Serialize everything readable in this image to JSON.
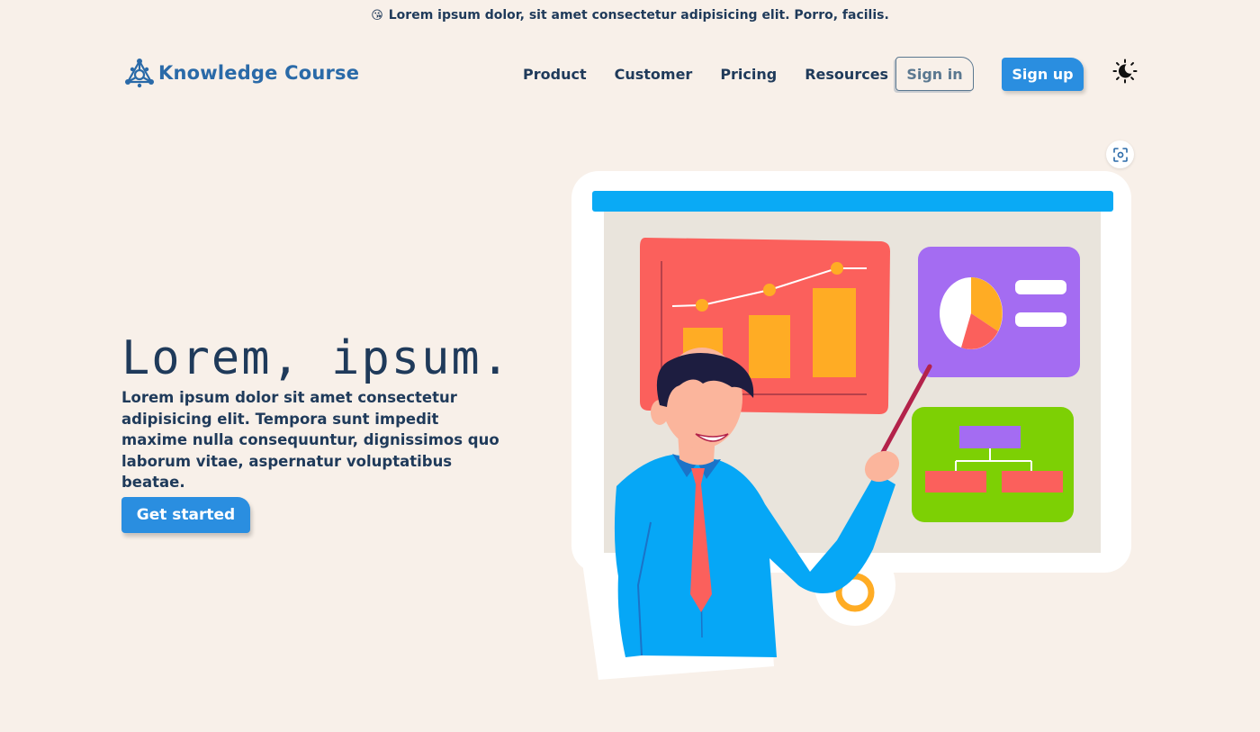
{
  "announcement": {
    "emoji": "😘",
    "text": "Lorem ipsum dolor, sit amet consectetur adipisicing elit. Porro, facilis."
  },
  "nav": {
    "logo_text": "Knowledge Course",
    "logo_icon": "network-triangle-icon",
    "links": [
      "Product",
      "Customer",
      "Pricing",
      "Resources"
    ],
    "signin_label": "Sign in",
    "signup_label": "Sign up",
    "theme_icon": "moon-sun-icon"
  },
  "hero": {
    "title": "Lorem, ipsum.",
    "description": "Lorem ipsum dolor sit amet consectetur adipisicing elit. Tempora sunt impedit maxime nulla consequuntur, dignissimos quo laborum vitae, aspernatur voluptatibus beatae.",
    "cta_label": "Get started"
  },
  "illustration": {
    "subject": "presenter-with-dashboard-board",
    "lens_icon": "visual-search-icon"
  },
  "colors": {
    "background": "#f8f0e9",
    "text": "#1f3a5a",
    "brand": "#2a6aa8",
    "button": "#2a8ee0"
  }
}
